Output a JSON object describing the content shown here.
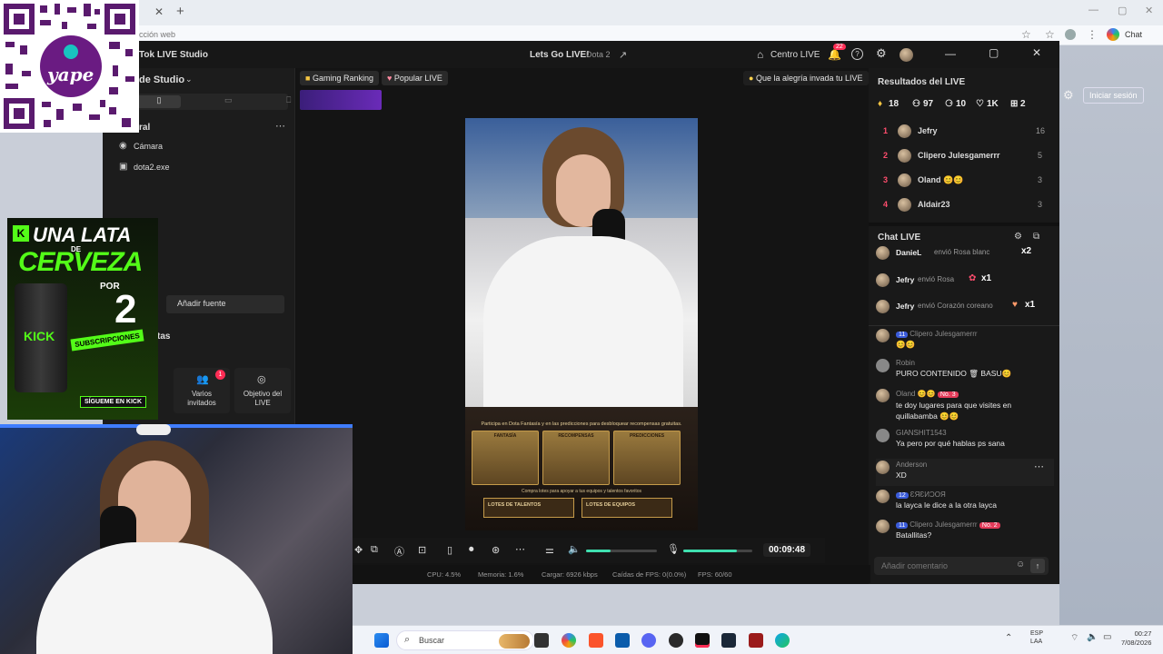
{
  "browser": {
    "address_placeholder": "ección web",
    "right_button": "Chat",
    "site_login": "Iniciar sesión"
  },
  "app": {
    "title": "Tok LIVE Studio",
    "stream_title": "Lets Go LIVE!",
    "game": "Dota 2",
    "centro_live": "Centro LIVE",
    "notif_count": "22"
  },
  "left": {
    "scene_label": "de Studio",
    "section_label": "ral",
    "sources": [
      "Cámara",
      "dota2.exe"
    ],
    "add_source": "Añadir fuente",
    "tools_label": "tas",
    "tools": [
      {
        "label": "Varios invitados",
        "badge": "1"
      },
      {
        "label": "Objetivo del LIVE"
      }
    ]
  },
  "stage": {
    "tags": [
      "Gaming Ranking",
      "Popular LIVE"
    ],
    "goal_text": "Que la alegría invada tu LIVE",
    "promo_line": "Participa en Dota Fantasía y en las predicciones para desbloquear recompensas gratuitas.",
    "cards": [
      "FANTASÍA",
      "RECOMPENSAS",
      "PREDICCIONES"
    ],
    "promo_line2": "Compra lotes para apoyar a tus equipos y talentos favoritos",
    "lots": [
      "LOTES DE TALENTOS",
      "LOTES DE EQUIPOS"
    ]
  },
  "controls": {
    "timer": "00:09:48",
    "volume_level": 0.35,
    "mic_level": 0.78
  },
  "status": {
    "cpu": "CPU: 4.5%",
    "mem": "Memoria: 1.6%",
    "upload": "Cargar: 6926 kbps",
    "frames": "Caídas de FPS: 0(0.0%)",
    "fps": "FPS: 60/60"
  },
  "results": {
    "title": "Resultados del LIVE",
    "stats": [
      "18",
      "97",
      "10",
      "1K",
      "2"
    ],
    "ranking": [
      {
        "pos": "1",
        "name": "Jefry",
        "score": "16"
      },
      {
        "pos": "2",
        "name": "Clipero Julesgamerrr",
        "score": "5"
      },
      {
        "pos": "3",
        "name": "Oland 😊😊",
        "score": "3"
      },
      {
        "pos": "4",
        "name": "Aldair23",
        "score": "3"
      }
    ]
  },
  "chat": {
    "title": "Chat LIVE",
    "gifts": [
      {
        "name": "DanieL",
        "text": "envió Rosa blanc",
        "mult": "x2"
      },
      {
        "name": "Jefry",
        "text": "envió Rosa",
        "mult": "x1"
      },
      {
        "name": "Jefry",
        "text": "envió Corazón coreano",
        "mult": "x1"
      }
    ],
    "messages": [
      {
        "name": "Clipero Julesgamerrr",
        "lvl": "11",
        "msg": "😊😊"
      },
      {
        "name": "Robin",
        "msg": "PURO CONTENIDO 🗑 BASU😊"
      },
      {
        "name": "Oland 😊😊",
        "rank": "No. 3",
        "msg": "te doy lugares para que visites en quillabamba 😊😊"
      },
      {
        "name": "GIANSHIT1543",
        "msg": "Ya pero por qué hablas ps sana"
      },
      {
        "name": "Anderson",
        "msg": "XD"
      },
      {
        "name": "ƐЯƐИƆOЯ",
        "lvl": "12",
        "msg": "la layca le dice a la otra layca"
      },
      {
        "name": "Clipero Julesgamerrr",
        "lvl": "11",
        "rank": "No. 2",
        "msg": "Batallitas?"
      }
    ],
    "input_placeholder": "Añadir comentario"
  },
  "overlays": {
    "yape": "yape",
    "beer_title": "UNA LATA",
    "beer_de": "DE",
    "beer_word": "CERVEZA",
    "beer_por": "POR",
    "beer_num": "2",
    "beer_subs": "SUBSCRIPCIONES",
    "beer_brand": "KICK",
    "beer_follow": "SÍGUEME EN KICK"
  },
  "taskbar": {
    "search": "Buscar",
    "lang1": "ESP",
    "lang2": "LAA",
    "time": "00:27",
    "date": "7/08/2026"
  }
}
